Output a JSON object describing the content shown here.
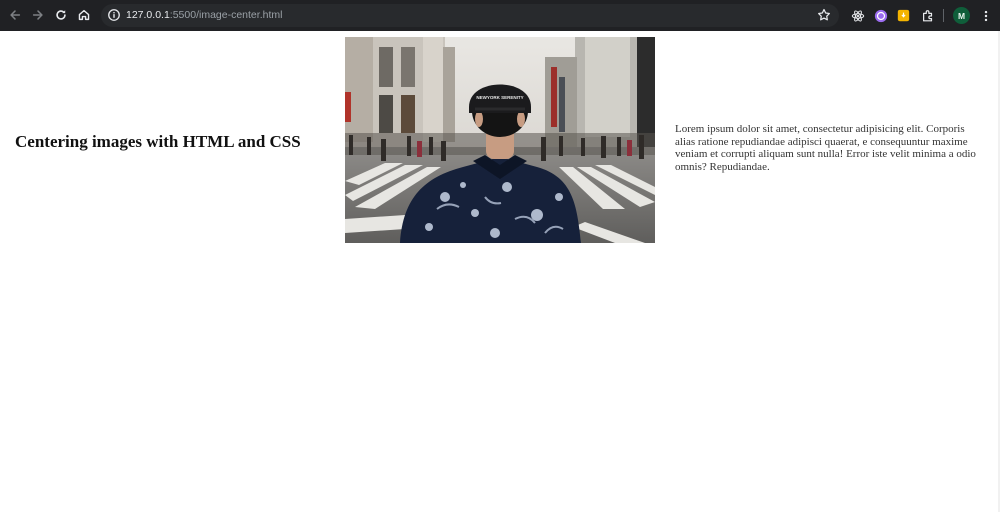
{
  "browser": {
    "url_host": "127.0.0.1",
    "url_rest": ":5500/image-center.html",
    "profile_initial": "M"
  },
  "page": {
    "heading": "Centering images with HTML and CSS",
    "paragraph": "Lorem ipsum dolor sit amet, consectetur adipisicing elit. Corporis alias ratione repudiandae adipisci quaerat, e consequuntur maxime veniam et corrupti aliquam sunt nulla! Error iste velit minima a odio omnis? Repudiandae.",
    "image_cap_text": "NEWYORK SERENITY"
  },
  "colors": {
    "chrome_bg": "#202124",
    "omnibox_bg": "#282a2d",
    "avatar_bg": "#0f5e3a"
  }
}
